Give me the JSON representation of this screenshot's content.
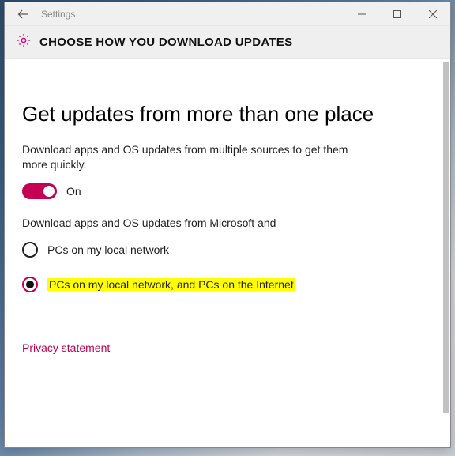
{
  "titlebar": {
    "title": "Settings"
  },
  "subheader": {
    "text": "CHOOSE HOW YOU DOWNLOAD UPDATES"
  },
  "main": {
    "heading": "Get updates from more than one place",
    "desc": "Download apps and OS updates from multiple sources to get them more quickly.",
    "toggle": {
      "state_label": "On",
      "value": true
    },
    "subdesc": "Download apps and OS updates from Microsoft and",
    "options": {
      "opt1": {
        "label": "PCs on my local network",
        "selected": false
      },
      "opt2": {
        "label": "PCs on my local network, and PCs on the Internet",
        "selected": true,
        "highlighted": true
      }
    },
    "privacy_link": "Privacy statement"
  }
}
